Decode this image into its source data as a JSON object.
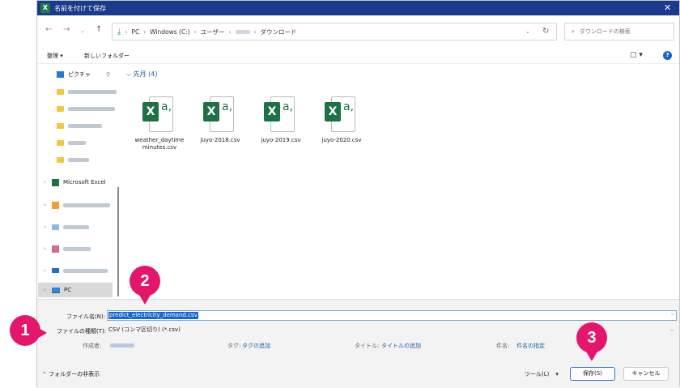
{
  "window": {
    "title": "名前を付けて保存",
    "close": "✕",
    "app_icon": "X"
  },
  "address": {
    "parts": [
      "PC",
      "Windows (C:)",
      "ユーザー",
      "ダウンロード"
    ],
    "search_placeholder": "ダウンロードの検索"
  },
  "toolbar": {
    "organize": "整理 ▾",
    "new_folder": "新しいフォルダー"
  },
  "nav": {
    "pictures": "ピクチャ",
    "microsoft_excel": "Microsoft Excel",
    "pc": "PC"
  },
  "content": {
    "group_label": "先月 (4)",
    "files": [
      {
        "name": "weather_daytime minutes.csv"
      },
      {
        "name": "juyo-2018.csv"
      },
      {
        "name": "juyo-2019.csv"
      },
      {
        "name": "juyo-2020.csv"
      }
    ]
  },
  "form": {
    "filename_label": "ファイル名(N):",
    "filename_value": "predict_electricity_demand.csv",
    "filetype_label": "ファイルの種類(T):",
    "filetype_value": "CSV (コンマ区切り) (*.csv)",
    "author_label": "作成者:",
    "tag_label": "タグ:",
    "tag_link": "タグの追加",
    "title_label": "タイトル:",
    "title_link": "タイトルの追加",
    "subject_label": "件名:",
    "subject_link": "件名の指定"
  },
  "footer": {
    "hide_folders": "フォルダーの非表示",
    "tools": "ツール(L)",
    "save": "保存(S)",
    "cancel": "キャンセル"
  },
  "annotations": {
    "one": "1",
    "two": "2",
    "three": "3"
  },
  "colors": {
    "accent": "#1a3a8c",
    "badge": "#e3166b",
    "excel": "#1e7145"
  }
}
